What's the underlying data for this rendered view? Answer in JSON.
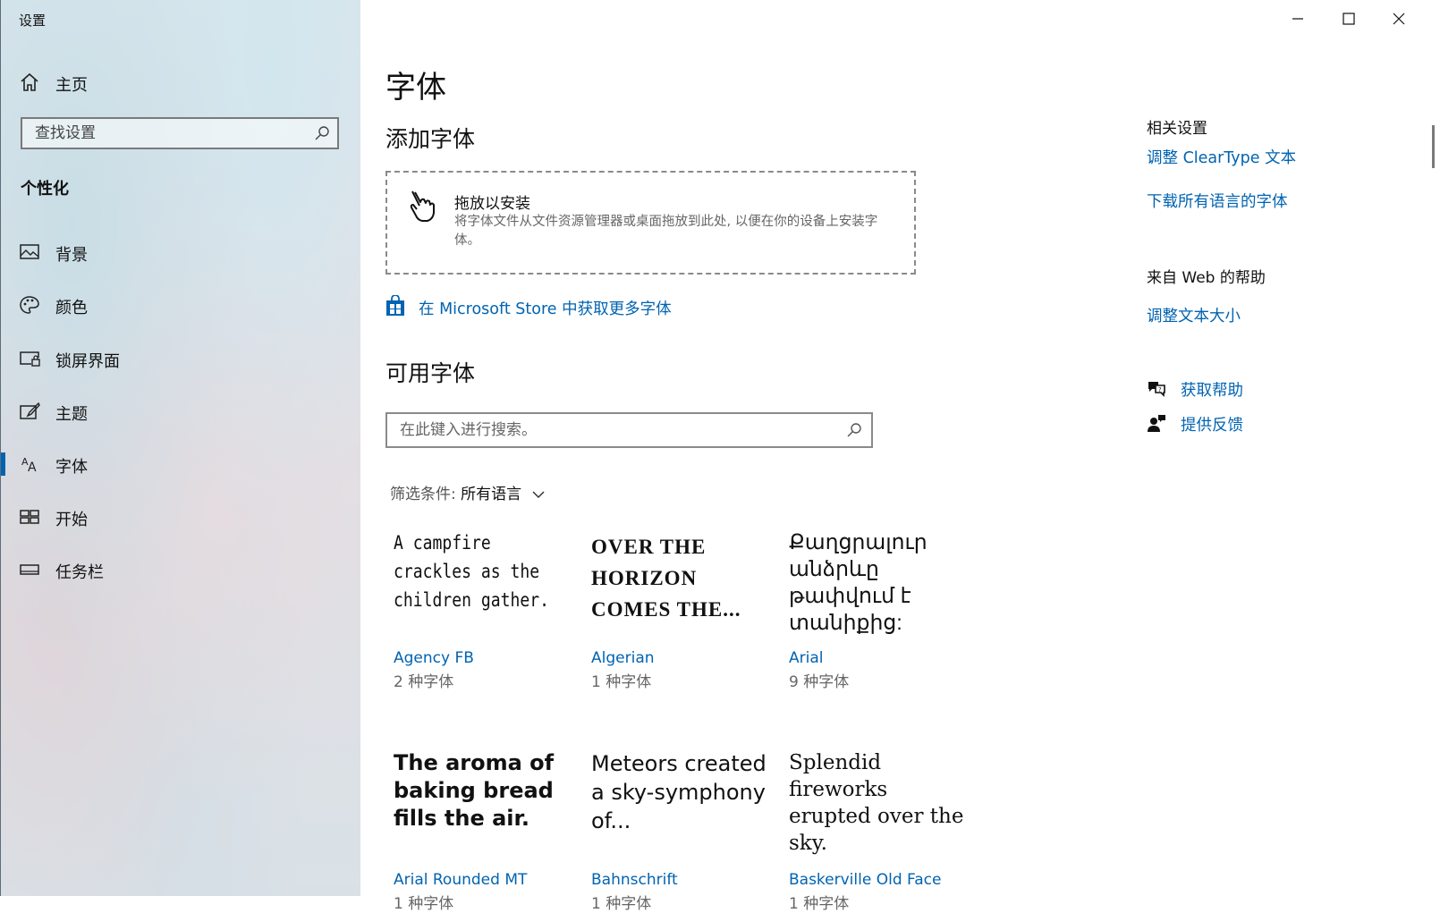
{
  "window": {
    "title": "设置"
  },
  "sidebar": {
    "home_label": "主页",
    "search_placeholder": "查找设置",
    "section_title": "个性化",
    "items": [
      {
        "label": "背景",
        "icon": "picture-icon"
      },
      {
        "label": "颜色",
        "icon": "palette-icon"
      },
      {
        "label": "锁屏界面",
        "icon": "lock-screen-icon"
      },
      {
        "label": "主题",
        "icon": "theme-brush-icon"
      },
      {
        "label": "字体",
        "icon": "font-icon",
        "active": true
      },
      {
        "label": "开始",
        "icon": "start-icon"
      },
      {
        "label": "任务栏",
        "icon": "taskbar-icon"
      }
    ]
  },
  "main": {
    "title": "字体",
    "add_fonts": {
      "heading": "添加字体",
      "drop_title": "拖放以安装",
      "drop_desc": "将字体文件从文件资源管理器或桌面拖放到此处, 以便在你的设备上安装字体。",
      "store_link": "在 Microsoft Store 中获取更多字体"
    },
    "available": {
      "heading": "可用字体",
      "search_placeholder": "在此键入进行搜索。",
      "filter_label": "筛选条件: ",
      "filter_value": "所有语言"
    },
    "fonts": [
      {
        "preview": "A campfire crackles as the children gather.",
        "name": "Agency FB",
        "count": "2 种字体"
      },
      {
        "preview": "OVER THE HORIZON COMES THE...",
        "name": "Algerian",
        "count": "1 种字体"
      },
      {
        "preview": "Քաղցրալուր անձրևը թափվում է տանիքից:",
        "name": "Arial",
        "count": "9 种字体"
      },
      {
        "preview": "The aroma of baking bread fills the air.",
        "name": "Arial Rounded MT",
        "count": "1 种字体"
      },
      {
        "preview": "Meteors created a sky-symphony of...",
        "name": "Bahnschrift",
        "count": "1 种字体"
      },
      {
        "preview": "Splendid fireworks erupted over the sky.",
        "name": "Baskerville Old Face",
        "count": "1 种字体"
      }
    ]
  },
  "related": {
    "heading": "相关设置",
    "links": [
      "调整 ClearType 文本",
      "下载所有语言的字体"
    ],
    "web_help_heading": "来自 Web 的帮助",
    "web_help_link": "调整文本大小",
    "get_help": "获取帮助",
    "feedback": "提供反馈"
  },
  "colors": {
    "accent": "#0063b1",
    "link": "#0063b1"
  }
}
